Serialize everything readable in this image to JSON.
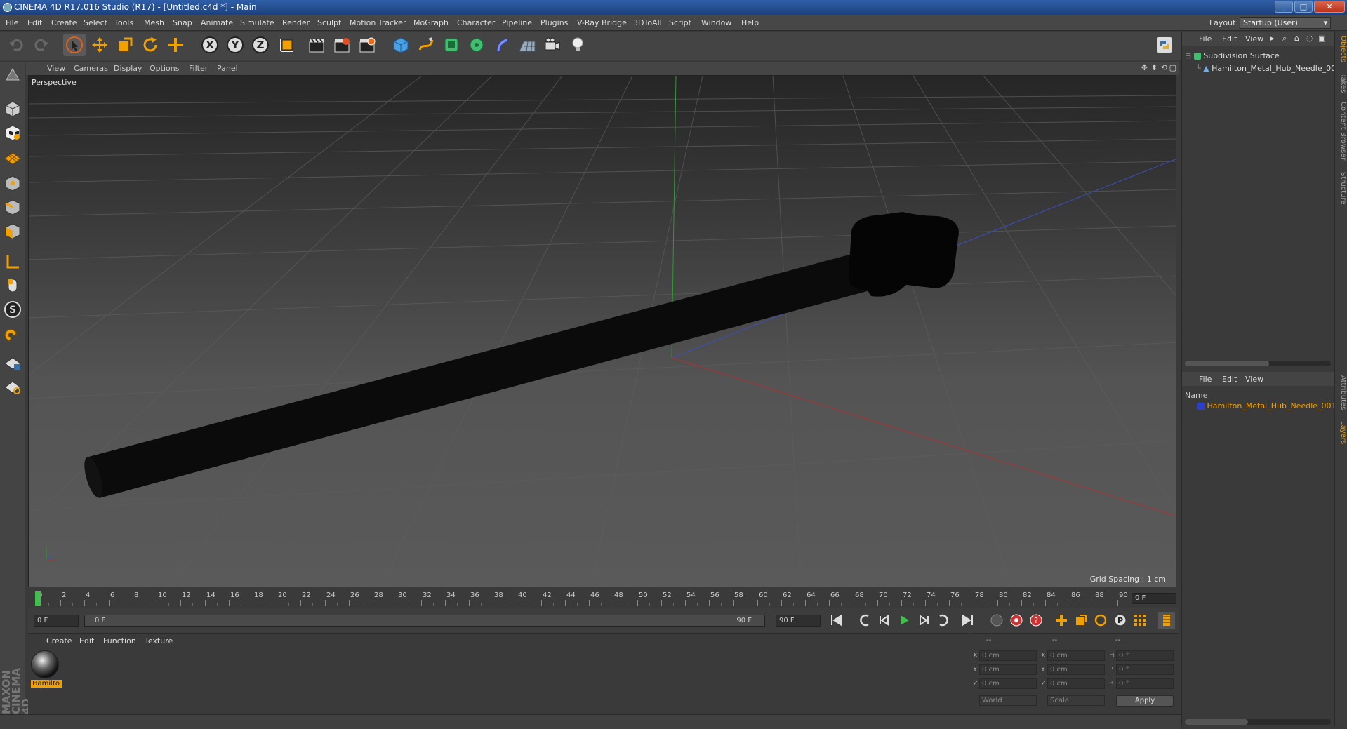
{
  "window": {
    "title": "CINEMA 4D R17.016 Studio (R17) - [Untitled.c4d *] - Main"
  },
  "menubar": {
    "items": [
      "File",
      "Edit",
      "Create",
      "Select",
      "Tools",
      "Mesh",
      "Snap",
      "Animate",
      "Simulate",
      "Render",
      "Sculpt",
      "Motion Tracker",
      "MoGraph",
      "Character",
      "Pipeline",
      "Plugins",
      "V-Ray Bridge",
      "3DToAll",
      "Script",
      "Window",
      "Help"
    ],
    "layout_label": "Layout:",
    "layout_value": "Startup (User)"
  },
  "viewport": {
    "menu": [
      "View",
      "Cameras",
      "Display",
      "Options",
      "Filter",
      "Panel"
    ],
    "label": "Perspective",
    "grid_spacing": "Grid Spacing : 1 cm"
  },
  "timeline": {
    "ticks": [
      "0",
      "2",
      "4",
      "6",
      "8",
      "10",
      "12",
      "14",
      "16",
      "18",
      "20",
      "22",
      "24",
      "26",
      "28",
      "30",
      "32",
      "34",
      "36",
      "38",
      "40",
      "42",
      "44",
      "46",
      "48",
      "50",
      "52",
      "54",
      "56",
      "58",
      "60",
      "62",
      "64",
      "66",
      "68",
      "70",
      "72",
      "74",
      "76",
      "78",
      "80",
      "82",
      "84",
      "86",
      "88",
      "90"
    ],
    "current_frame": "0 F",
    "start_field": "0 F",
    "slider_start": "0 F",
    "slider_end": "90 F",
    "end_field": "90 F"
  },
  "material_manager": {
    "menu": [
      "Create",
      "Edit",
      "Function",
      "Texture"
    ],
    "material_name": "Hamilto"
  },
  "coordinates": {
    "header_dashes": [
      "--",
      "--",
      "--"
    ],
    "rows": [
      {
        "a": "X",
        "av": "0 cm",
        "b": "X",
        "bv": "0 cm",
        "c": "H",
        "cv": "0 °"
      },
      {
        "a": "Y",
        "av": "0 cm",
        "b": "Y",
        "bv": "0 cm",
        "c": "P",
        "cv": "0 °"
      },
      {
        "a": "Z",
        "av": "0 cm",
        "b": "Z",
        "bv": "0 cm",
        "c": "B",
        "cv": "0 °"
      }
    ],
    "world": "World",
    "scale": "Scale",
    "apply": "Apply"
  },
  "object_manager": {
    "menu": [
      "File",
      "Edit",
      "View"
    ],
    "objects": [
      "Subdivision Surface",
      "Hamilton_Metal_Hub_Needle_00"
    ]
  },
  "layer_manager": {
    "menu": [
      "File",
      "Edit",
      "View"
    ],
    "col_name": "Name",
    "layers": [
      "Hamilton_Metal_Hub_Needle_001"
    ]
  },
  "side_tabs": [
    "Objects",
    "Takes",
    "Content Browser",
    "Structure",
    "Attributes",
    "Layers"
  ],
  "brand": "MAXON CINEMA 4D",
  "colors": {
    "accent": "#f0a000",
    "x_axis": "#b03030",
    "y_axis": "#2f9b2f",
    "z_axis": "#3b4fc0"
  }
}
